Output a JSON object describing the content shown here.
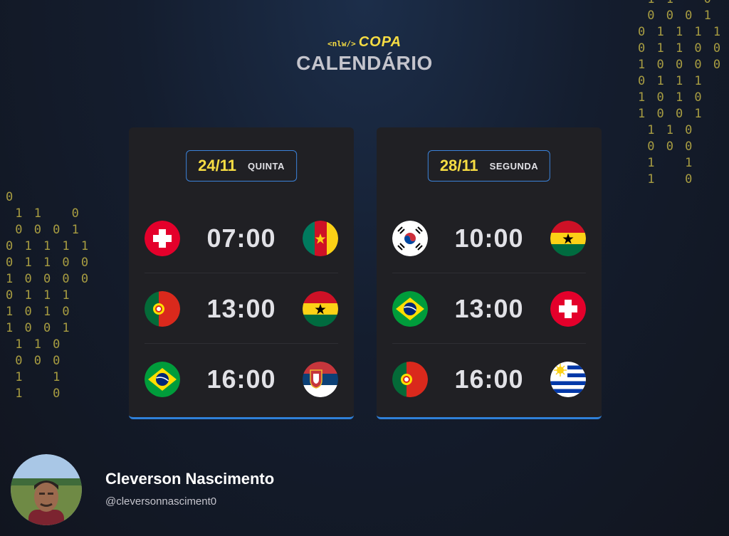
{
  "header": {
    "logo_prefix": "<nlw/>",
    "logo_name": "COPA",
    "title": "CALENDÁRIO"
  },
  "decor": {
    "binary_left": "0\n 1 1   0\n 0 0 0 1\n0 1 1 1 1\n0 1 1 0 0\n1 0 0 0 0\n0 1 1 1\n1 0 1 0\n1 0 0 1\n 1 1 0\n 0 0 0\n 1   1\n 1   0",
    "binary_right": " 1 1   0\n 0 0 0 1\n0 1 1 1 1\n0 1 1 0 0\n1 0 0 0 0\n0 1 1 1\n1 0 1 0\n1 0 0 1\n 1 1 0\n 0 0 0\n 1   1\n 1   0",
    "binary_color": "#d9c84a"
  },
  "colors": {
    "accent_yellow": "#f7dd43",
    "accent_blue": "#2f80d8",
    "card_bg": "#202024"
  },
  "days": [
    {
      "date": "24/11",
      "weekday": "QUINTA",
      "matches": [
        {
          "home": "switzerland-flag",
          "time": "07:00",
          "away": "cameroon-flag"
        },
        {
          "home": "portugal-flag",
          "time": "13:00",
          "away": "ghana-flag"
        },
        {
          "home": "brazil-flag",
          "time": "16:00",
          "away": "serbia-flag"
        }
      ]
    },
    {
      "date": "28/11",
      "weekday": "SEGUNDA",
      "matches": [
        {
          "home": "south-korea-flag",
          "time": "10:00",
          "away": "ghana-flag"
        },
        {
          "home": "brazil-flag",
          "time": "13:00",
          "away": "switzerland-flag"
        },
        {
          "home": "portugal-flag",
          "time": "16:00",
          "away": "uruguay-flag"
        }
      ]
    }
  ],
  "profile": {
    "name": "Cleverson Nascimento",
    "handle": "@cleversonnasciment0",
    "avatar_icon": "user-photo-avatar"
  }
}
